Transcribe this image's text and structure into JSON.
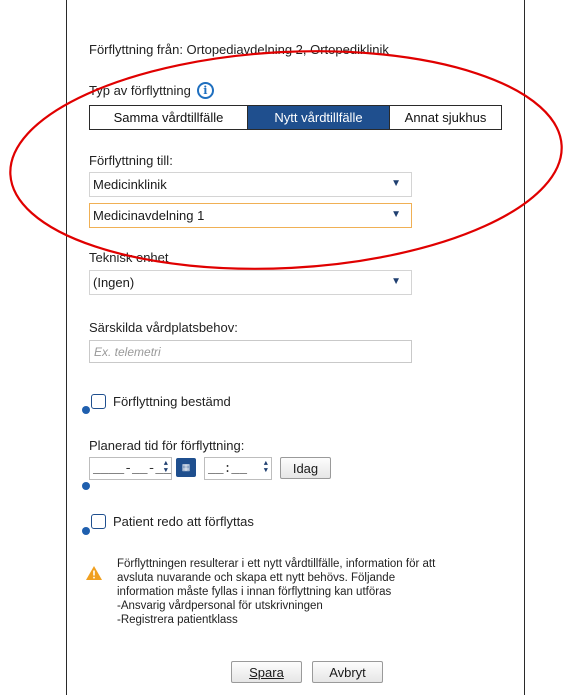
{
  "from_label": "Förflyttning från: Ortopediavdelning 2, Ortopediklinik",
  "typ_label": "Typ av förflyttning",
  "info_glyph": "i",
  "segments": [
    {
      "label": "Samma vårdtillfälle",
      "active": false
    },
    {
      "label": "Nytt vårdtillfälle",
      "active": true
    },
    {
      "label": "Annat sjukhus",
      "active": false
    }
  ],
  "till_label": "Förflyttning till:",
  "klinik_value": "Medicinklinik",
  "avdelning_value": "Medicinavdelning 1",
  "teknisk_label": "Teknisk enhet",
  "teknisk_value": "(Ingen)",
  "sarskilda_label": "Särskilda vårdplatsbehov:",
  "sarskilda_placeholder": "Ex. telemetri",
  "bestamd_label": "Förflyttning bestämd",
  "planerad_label": "Planerad tid för förflyttning:",
  "date_value": "____-__-__",
  "time_value": "__:__",
  "idag_label": "Idag",
  "redo_label": "Patient redo att förflyttas",
  "warning_lines": [
    "Förflyttningen resulterar i ett nytt vårdtillfälle, information för att",
    "avsluta nuvarande och skapa ett nytt behövs. Följande",
    "information måste fyllas i innan förflyttning kan utföras",
    "-Ansvarig vårdpersonal för utskrivningen",
    "-Registrera patientklass"
  ],
  "spara_label": "Spara",
  "avbryt_label": "Avbryt",
  "colors": {
    "accent": "#1f4f8e",
    "annotation": "#e00000",
    "warning": "#f0a020"
  },
  "icons": {
    "info": "info-icon",
    "calendar": "calendar-icon",
    "warning": "warning-icon",
    "dropdown": "caret-down-icon"
  }
}
